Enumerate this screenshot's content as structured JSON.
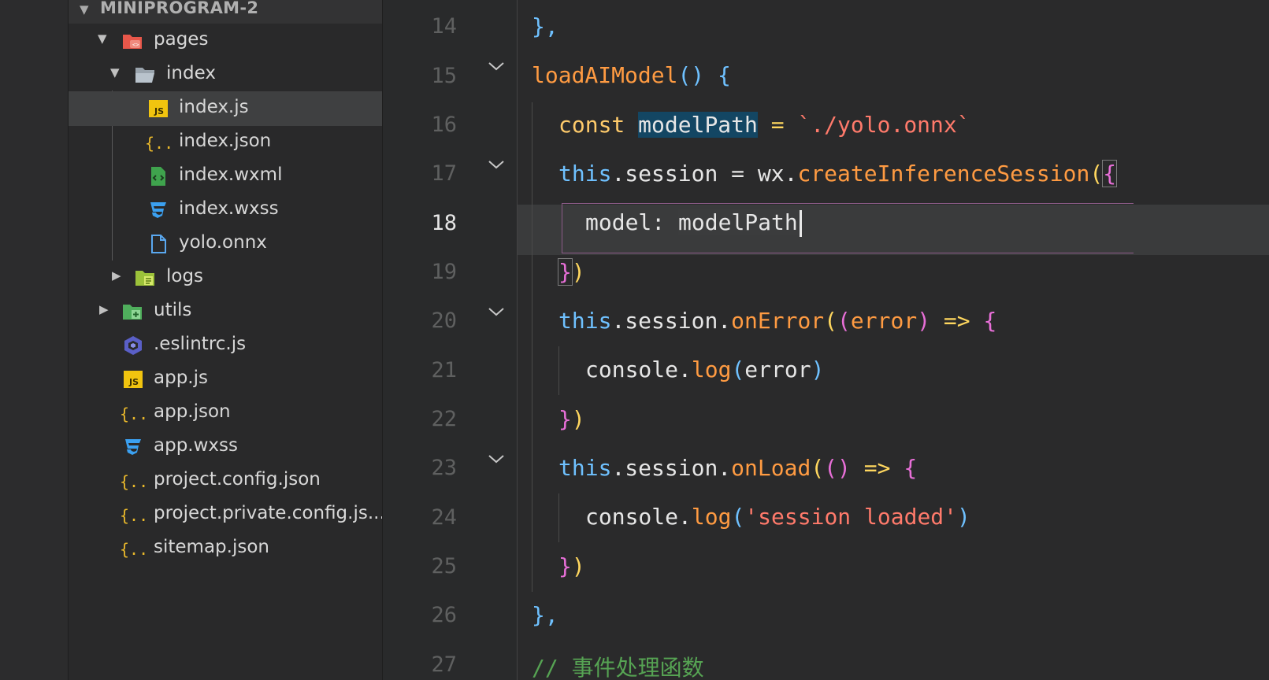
{
  "explorer": {
    "section_title": "MINIPROGRAM-2",
    "tree": [
      {
        "label": "pages",
        "icon": "pages-folder-icon",
        "caret": "▼"
      },
      {
        "label": "index",
        "icon": "folder-open-icon",
        "caret": "▼"
      },
      {
        "label": "index.js",
        "icon": "js-file-icon",
        "selected": true
      },
      {
        "label": "index.json",
        "icon": "json-file-icon"
      },
      {
        "label": "index.wxml",
        "icon": "wxml-file-icon"
      },
      {
        "label": "index.wxss",
        "icon": "css-file-icon"
      },
      {
        "label": "yolo.onnx",
        "icon": "generic-file-icon"
      },
      {
        "label": "logs",
        "icon": "logs-folder-icon",
        "caret": "▶"
      },
      {
        "label": "utils",
        "icon": "utils-folder-icon",
        "caret": "▶"
      },
      {
        "label": ".eslintrc.js",
        "icon": "eslint-file-icon"
      },
      {
        "label": "app.js",
        "icon": "js-file-icon"
      },
      {
        "label": "app.json",
        "icon": "json-file-icon"
      },
      {
        "label": "app.wxss",
        "icon": "css-file-icon"
      },
      {
        "label": "project.config.json",
        "icon": "json-file-icon"
      },
      {
        "label": "project.private.config.js...",
        "icon": "json-file-icon"
      },
      {
        "label": "sitemap.json",
        "icon": "json-file-icon"
      }
    ]
  },
  "editor": {
    "active_line": "18",
    "line_numbers": [
      "14",
      "15",
      "16",
      "17",
      "18",
      "19",
      "20",
      "21",
      "22",
      "23",
      "24",
      "25",
      "26",
      "27"
    ],
    "code": {
      "l14": {
        "t1": "},"
      },
      "l15": {
        "t1": "loadAIModel",
        "t2": "()",
        "t3": " {"
      },
      "l16": {
        "t1": "const",
        "t2": "modelPath",
        "t3": " = ",
        "t4": "`./yolo.onnx`"
      },
      "l17": {
        "t1": "this",
        "t2": ".session = wx.",
        "t3": "createInferenceSession",
        "t4": "(",
        "t5": "{"
      },
      "l18": {
        "t1": "model: ",
        "t2": "modelPath"
      },
      "l19": {
        "t1": "}",
        "t2": ")"
      },
      "l20": {
        "t1": "this",
        "t2": ".session.",
        "t3": "onError",
        "t4": "(",
        "t5": "(",
        "t6": "error",
        "t7": ")",
        "t8": " => ",
        "t9": "{"
      },
      "l21": {
        "t1": "console.",
        "t2": "log",
        "t3": "(",
        "t4": "error",
        "t5": ")"
      },
      "l22": {
        "t1": "}",
        "t2": ")"
      },
      "l23": {
        "t1": "this",
        "t2": ".session.",
        "t3": "onLoad",
        "t4": "(",
        "t5": "()",
        "t6": " => ",
        "t7": "{"
      },
      "l24": {
        "t1": "console.",
        "t2": "log",
        "t3": "(",
        "t4": "'session loaded'",
        "t5": ")"
      },
      "l25": {
        "t1": "}",
        "t2": ")"
      },
      "l26": {
        "t1": "},"
      },
      "l27": {
        "t1": "// 事件处理函数"
      }
    }
  }
}
